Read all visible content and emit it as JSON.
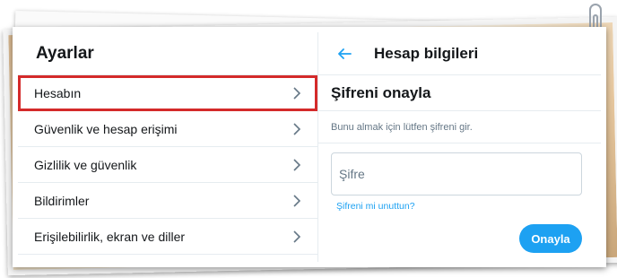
{
  "left_panel": {
    "title": "Ayarlar",
    "items": [
      {
        "label": "Hesabın"
      },
      {
        "label": "Güvenlik ve hesap erişimi"
      },
      {
        "label": "Gizlilik ve güvenlik"
      },
      {
        "label": "Bildirimler"
      },
      {
        "label": "Erişilebilirlik, ekran ve diller"
      }
    ]
  },
  "right_panel": {
    "title": "Hesap bilgileri",
    "section_title": "Şifreni onayla",
    "helper_text": "Bunu almak için lütfen şifreni gir.",
    "password_placeholder": "Şifre",
    "forgot_link": "Şifreni mi unuttun?",
    "confirm_label": "Onayla"
  },
  "colors": {
    "accent": "#1da1f2",
    "highlight_border": "#d42a2a",
    "divider": "#e6ecf0"
  },
  "icons": {
    "back": "arrow-left-icon",
    "item_chevron": "chevron-right-icon"
  }
}
